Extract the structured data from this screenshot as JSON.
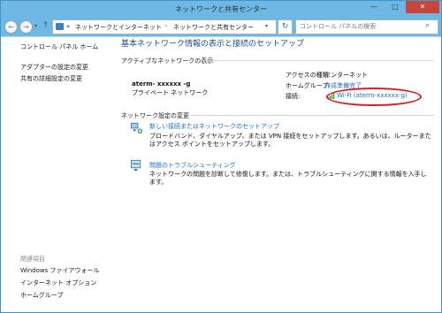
{
  "window": {
    "title": "ネットワークと共有センター",
    "minimize_glyph": "—",
    "maximize_glyph": "□",
    "close_glyph": "✕"
  },
  "address_bar": {
    "back_glyph": "←",
    "forward_glyph": "→",
    "dropdown_glyph": "▾",
    "up_glyph": "↑",
    "path_prefix": "«",
    "path_sep": "›",
    "path": [
      "ネットワークとインターネット",
      "ネットワークと共有センター"
    ],
    "refresh_glyph": "↻",
    "search_placeholder": "コントロール パネルの検索",
    "search_glyph": "⌕"
  },
  "sidebar": {
    "home": "コントロール パネル ホーム",
    "links": [
      "アダプターの設定の変更",
      "共有の詳細設定の変更"
    ],
    "related_heading": "関連項目",
    "related_links": [
      "Windows ファイアウォール",
      "インターネット オプション",
      "ホームグループ"
    ]
  },
  "main": {
    "heading": "基本ネットワーク情報の表示と接続のセットアップ",
    "active_section_title": "アクティブなネットワークの表示",
    "network_name": "aterm- xxxxxx -g",
    "network_type": "プライベート ネットワーク",
    "access_type_label": "アクセスの種類:",
    "access_type_value": "インターネット",
    "homegroup_label": "ホームグループ:",
    "homegroup_value": "作成準備完了",
    "connection_label": "接続:",
    "connection_value": "Wi-Fi (aterm-xxxxxx-g)",
    "settings_section_title": "ネットワーク設定の変更",
    "tasks": [
      {
        "title": "新しい接続またはネットワークのセットアップ",
        "description": "ブロードバンド、ダイヤルアップ、または VPN 接続をセットアップします。あるいは、ルーターまたはアクセス ポイントをセットアップします。"
      },
      {
        "title": "問題のトラブルシューティング",
        "description": "ネットワークの問題を診断して修復します。または、トラブルシューティングに関する情報を入手します。"
      }
    ]
  },
  "colors": {
    "titlebar": "#6fb8e3",
    "link": "#1e6fbf",
    "heading": "#1e4e8c",
    "highlight": "#e0181b"
  }
}
